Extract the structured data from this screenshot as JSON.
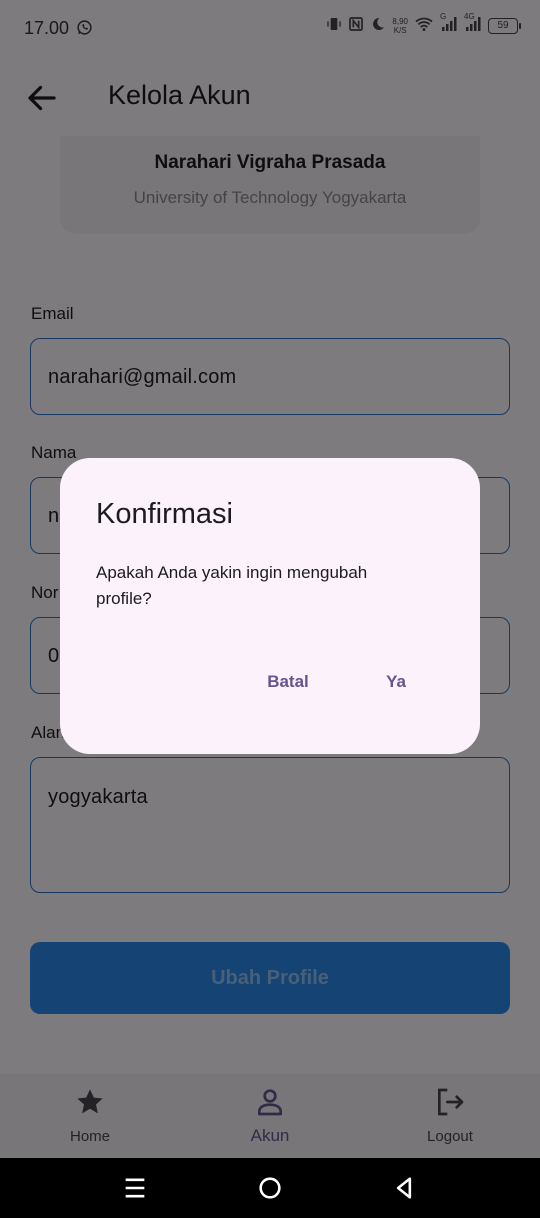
{
  "status_bar": {
    "time": "17.00",
    "net_speed_value": "8,90",
    "net_speed_unit": "K/S",
    "signal_1_label": "G",
    "signal_2_label": "4G",
    "battery": "59"
  },
  "app_bar": {
    "title": "Kelola Akun",
    "back_icon": "arrow-left-icon"
  },
  "profile": {
    "name": "Narahari Vigraha Prasada",
    "university": "University of Technology Yogyakarta"
  },
  "form": {
    "email": {
      "label": "Email",
      "value": "narahari@gmail.com"
    },
    "nama": {
      "label": "Nama",
      "value": "n"
    },
    "nomor": {
      "label": "Nor",
      "value": "0"
    },
    "alamat": {
      "label": "Alan",
      "value": "yogyakarta"
    },
    "submit_label": "Ubah Profile"
  },
  "dialog": {
    "title": "Konfirmasi",
    "message": "Apakah Anda yakin ingin mengubah profile?",
    "cancel_label": "Batal",
    "confirm_label": "Ya"
  },
  "bottom_nav": {
    "items": [
      {
        "label": "Home",
        "icon": "star-icon",
        "active": false
      },
      {
        "label": "Akun",
        "icon": "person-icon",
        "active": true
      },
      {
        "label": "Logout",
        "icon": "logout-icon",
        "active": false
      }
    ]
  },
  "colors": {
    "accent": "#65558f",
    "field_border": "#2a73c9",
    "button": "#2b86e6",
    "scrim": "rgba(0,0,0,0.5)"
  }
}
